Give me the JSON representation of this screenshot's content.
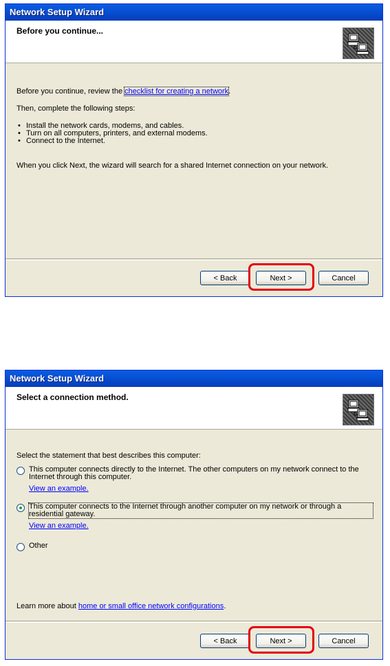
{
  "window1": {
    "title": "Network Setup Wizard",
    "header_title": "Before you continue...",
    "intro_prefix": "Before you continue, review the ",
    "checklist_link": "checklist for creating a network",
    "intro_suffix": ".",
    "steps_intro": "Then, complete the following steps:",
    "steps": [
      "Install the network cards, modems, and cables.",
      "Turn on all computers, printers, and external modems.",
      "Connect to the Internet."
    ],
    "next_note": "When you click Next, the wizard will search for a shared Internet connection on your network.",
    "back_label": "< Back",
    "next_label": "Next >",
    "cancel_label": "Cancel"
  },
  "window2": {
    "title": "Network Setup Wizard",
    "header_title": "Select a connection method.",
    "prompt": "Select the statement that best describes this computer:",
    "options": [
      {
        "label": "This computer connects directly to the Internet. The other computers on my network connect to the Internet through this computer.",
        "example_link": "View an example.",
        "selected": false
      },
      {
        "label": "This computer connects to the Internet through another computer on my network or through a residential gateway.",
        "example_link": "View an example.",
        "selected": true
      },
      {
        "label": "Other",
        "selected": false
      }
    ],
    "learn_prefix": "Learn more about ",
    "learn_link": "home or small office network configurations",
    "learn_suffix": ".",
    "back_label": "< Back",
    "next_label": "Next >",
    "cancel_label": "Cancel"
  }
}
